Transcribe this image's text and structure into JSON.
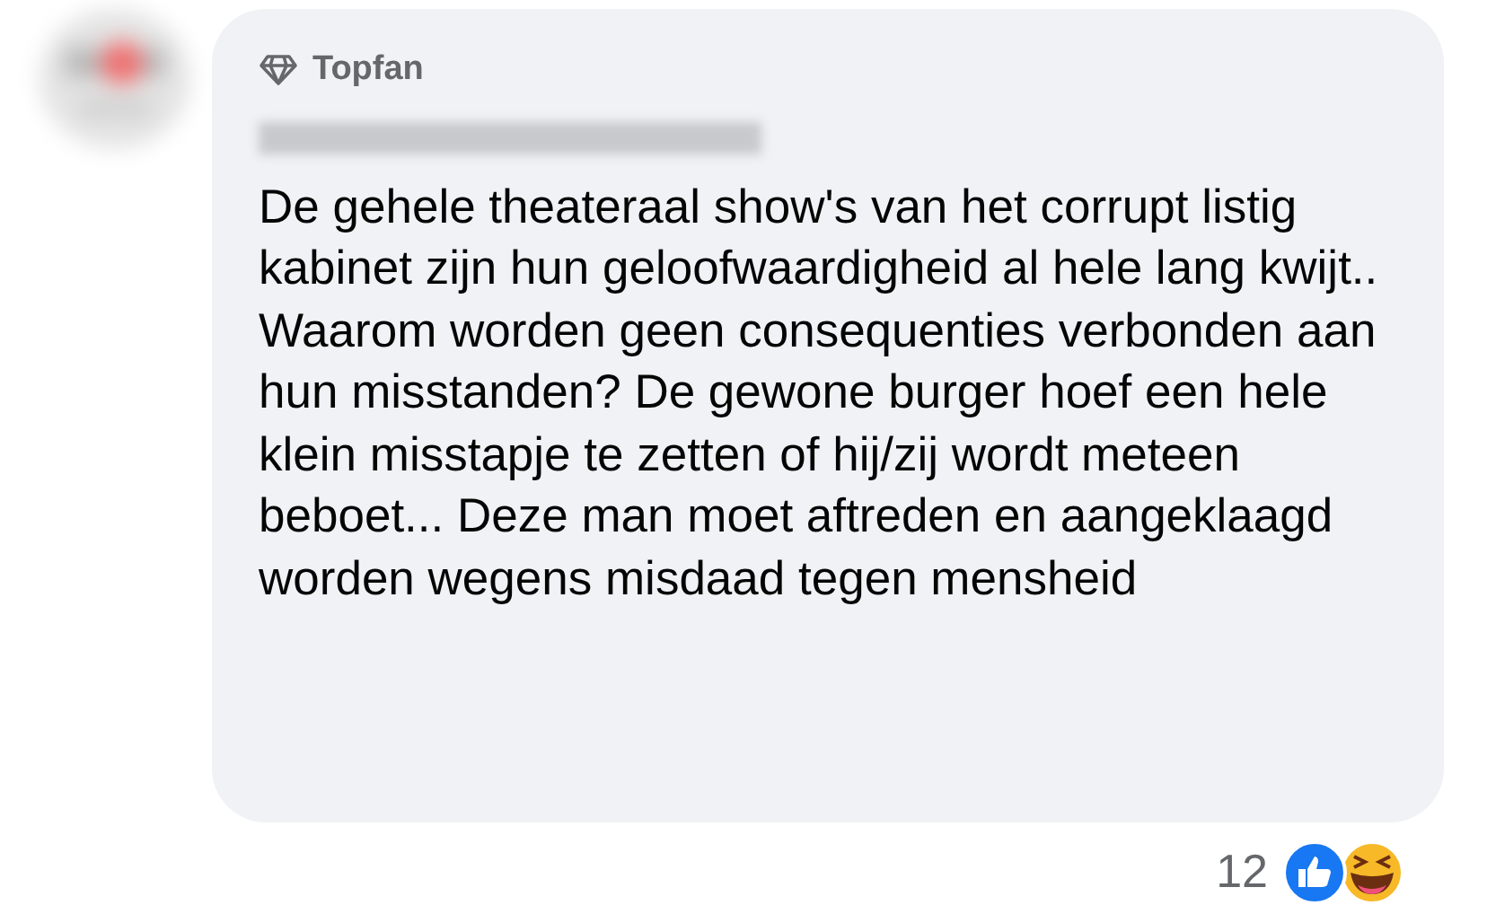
{
  "comment": {
    "badge": "Topfan",
    "text": "De gehele theateraal show's van het corrupt listig kabinet zijn hun geloofwaardigheid al hele lang kwijt.. Waarom worden geen consequenties verbonden aan hun misstanden? De gewone burger hoef een hele klein misstapje te zetten of hij/zij wordt meteen beboet... Deze man moet aftreden en aangeklaagd worden wegens misdaad tegen mensheid"
  },
  "reactions": {
    "count": "12"
  }
}
